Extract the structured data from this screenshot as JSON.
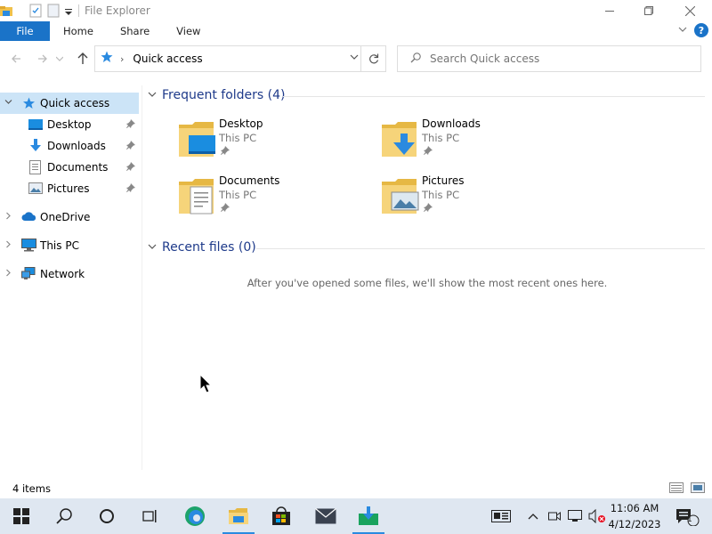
{
  "window": {
    "title": "File Explorer"
  },
  "ribbon": {
    "file_tab": "File",
    "tabs": [
      "Home",
      "Share",
      "View"
    ]
  },
  "address": {
    "location": "Quick access",
    "search_placeholder": "Search Quick access"
  },
  "sidebar": {
    "items": [
      {
        "label": "Quick access",
        "icon": "star-icon"
      },
      {
        "label": "Desktop",
        "icon": "desktop-icon",
        "pinned": true
      },
      {
        "label": "Downloads",
        "icon": "download-icon",
        "pinned": true
      },
      {
        "label": "Documents",
        "icon": "documents-icon",
        "pinned": true
      },
      {
        "label": "Pictures",
        "icon": "pictures-icon",
        "pinned": true
      },
      {
        "label": "OneDrive",
        "icon": "cloud-icon"
      },
      {
        "label": "This PC",
        "icon": "computer-icon"
      },
      {
        "label": "Network",
        "icon": "network-icon"
      }
    ]
  },
  "content": {
    "frequent_header": "Frequent folders (4)",
    "recent_header": "Recent files (0)",
    "folders": [
      {
        "name": "Desktop",
        "location": "This PC"
      },
      {
        "name": "Downloads",
        "location": "This PC"
      },
      {
        "name": "Documents",
        "location": "This PC"
      },
      {
        "name": "Pictures",
        "location": "This PC"
      }
    ],
    "empty_message": "After you've opened some files, we'll show the most recent ones here."
  },
  "status": {
    "items_count": "4 items"
  },
  "taskbar": {
    "time": "11:06 AM",
    "date": "4/12/2023",
    "notification_count": "1"
  },
  "colors": {
    "accent": "#1a73c8",
    "selection": "#cce4f7",
    "taskbar": "#dfe7f1",
    "header": "#1e3a8a"
  }
}
